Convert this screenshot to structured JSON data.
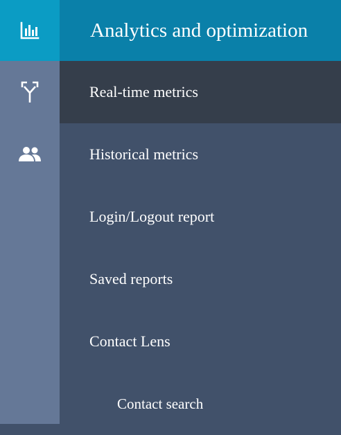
{
  "rail": {
    "items": [
      {
        "icon": "bar-chart-icon",
        "active": true
      },
      {
        "icon": "routing-icon",
        "active": false
      },
      {
        "icon": "users-icon",
        "active": false
      }
    ]
  },
  "panel": {
    "title": "Analytics and optimization",
    "items": [
      {
        "label": "Real-time metrics",
        "selected": true
      },
      {
        "label": "Historical metrics"
      },
      {
        "label": "Login/Logout report"
      },
      {
        "label": "Saved reports"
      },
      {
        "label": "Contact Lens"
      },
      {
        "label": "Contact search"
      }
    ]
  },
  "colors": {
    "rail_bg": "#657897",
    "rail_active": "#0b9cc4",
    "header_bg": "#0a80a9",
    "panel_bg": "#41516a",
    "selected_bg": "#353e4b",
    "text": "#ffffff"
  }
}
